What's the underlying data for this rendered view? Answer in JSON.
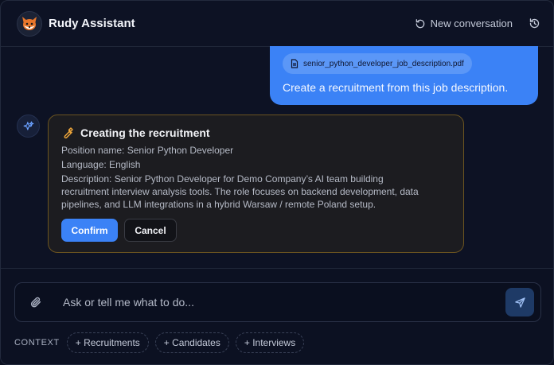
{
  "header": {
    "title": "Rudy Assistant",
    "new_conversation_label": "New conversation"
  },
  "messages": {
    "user": {
      "attachment_name": "senior_python_developer_job_description.pdf",
      "text": "Create a recruitment from this job description."
    },
    "assistant": {
      "card_title": "Creating the recruitment",
      "position_line": "Position name: Senior Python Developer",
      "language_line": "Language: English",
      "description_line1": "Description: Senior Python Developer for Demo Company’s AI team building",
      "description_line2": "recruitment interview analysis tools. The role focuses on backend development, data",
      "description_line3": "pipelines, and LLM integrations in a hybrid Warsaw / remote Poland setup.",
      "confirm_label": "Confirm",
      "cancel_label": "Cancel"
    }
  },
  "composer": {
    "placeholder": "Ask or tell me what to do..."
  },
  "context": {
    "label": "CONTEXT",
    "chips": [
      "+ Recruitments",
      "+ Candidates",
      "+ Interviews"
    ]
  },
  "colors": {
    "accent": "#3b82f6",
    "background": "#0d1224",
    "card_border": "#6b5420",
    "wrench": "#f0a73a"
  },
  "icons": {
    "avatar": "fox-avatar-icon",
    "new_conversation": "refresh-icon",
    "history": "history-icon",
    "attachment": "document-icon",
    "assistant": "sparkles-icon",
    "card": "wrench-icon",
    "attach": "paperclip-icon",
    "send": "send-icon"
  }
}
